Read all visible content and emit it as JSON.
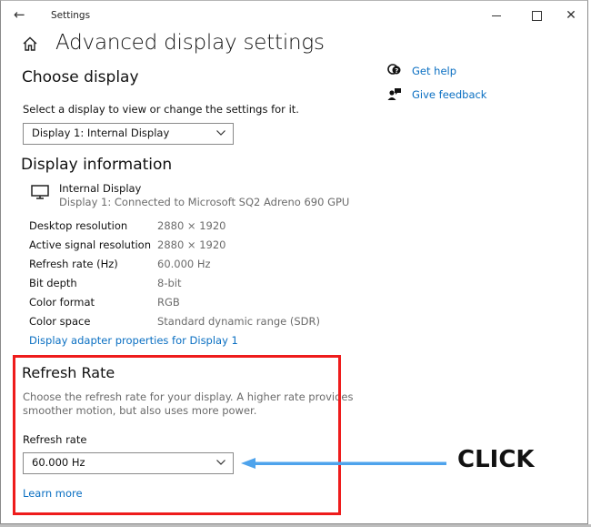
{
  "window": {
    "title": "Settings",
    "back_icon": "back-arrow-icon",
    "minimize_icon": "minimize-icon",
    "maximize_icon": "maximize-icon",
    "close_icon": "close-icon",
    "back_glyph": "←",
    "close_glyph": "✕"
  },
  "page": {
    "home_icon": "home-icon",
    "title": "Advanced display settings"
  },
  "sidebar_links": [
    {
      "label": "Get help",
      "icon": "help-chat-icon"
    },
    {
      "label": "Give feedback",
      "icon": "feedback-icon"
    }
  ],
  "choose_display": {
    "heading": "Choose display",
    "description": "Select a display to view or change the settings for it.",
    "selected": "Display 1: Internal Display"
  },
  "display_information": {
    "heading": "Display information",
    "monitor_icon": "monitor-icon",
    "display_name": "Internal Display",
    "connection": "Display 1: Connected to Microsoft SQ2 Adreno 690 GPU",
    "rows": [
      {
        "label": "Desktop resolution",
        "value": "2880 × 1920"
      },
      {
        "label": "Active signal resolution",
        "value": "2880 × 1920"
      },
      {
        "label": "Refresh rate (Hz)",
        "value": "60.000 Hz"
      },
      {
        "label": "Bit depth",
        "value": "8-bit"
      },
      {
        "label": "Color format",
        "value": "RGB"
      },
      {
        "label": "Color space",
        "value": "Standard dynamic range (SDR)"
      }
    ],
    "adapter_link": "Display adapter properties for Display 1"
  },
  "refresh_rate": {
    "heading": "Refresh Rate",
    "description_line1": "Choose the refresh rate for your display. A higher rate provides",
    "description_line2": "smoother motion, but also uses more power.",
    "field_label": "Refresh rate",
    "selected": "60.000 Hz",
    "learn_more": "Learn more"
  },
  "annotation": {
    "label": "CLICK",
    "highlight_color": "#ee1c1c",
    "arrow_color": "#4ea3ec"
  },
  "colors": {
    "link": "#0a6fc2",
    "secondary_text": "#6b6b6b"
  }
}
